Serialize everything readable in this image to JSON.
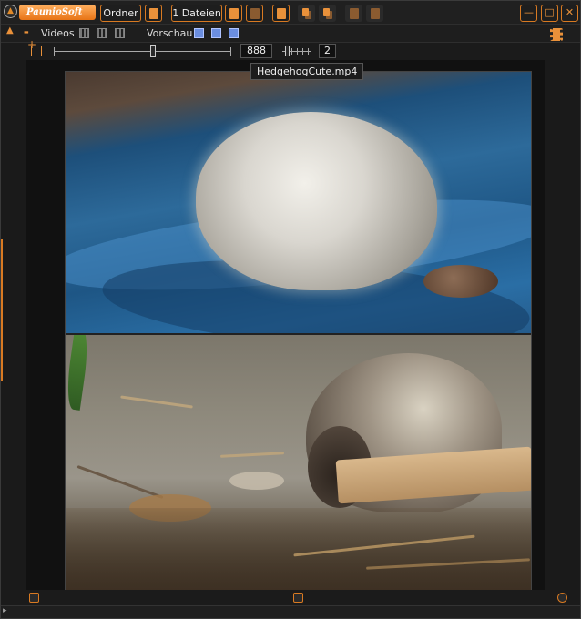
{
  "app": {
    "logo_text": "PaunioSoft",
    "logo_glyph": "▲"
  },
  "toolbar": {
    "folder_button": "Ordner",
    "files_button": "1 Dateien",
    "minimize_glyph": "—",
    "maximize_glyph": "□",
    "close_glyph": "✕"
  },
  "menubar": {
    "up_arrow": "▲",
    "down_arrow": "▬",
    "videos_label": "Videos",
    "preview_label": "Vorschau"
  },
  "zoom": {
    "size_value": "888",
    "columns_value": "2"
  },
  "preview": {
    "tooltip": "HedgehogCute.mp4"
  },
  "status": {
    "arrow": "▸"
  },
  "colors": {
    "accent": "#d97a22",
    "background": "#1b1b1b"
  }
}
